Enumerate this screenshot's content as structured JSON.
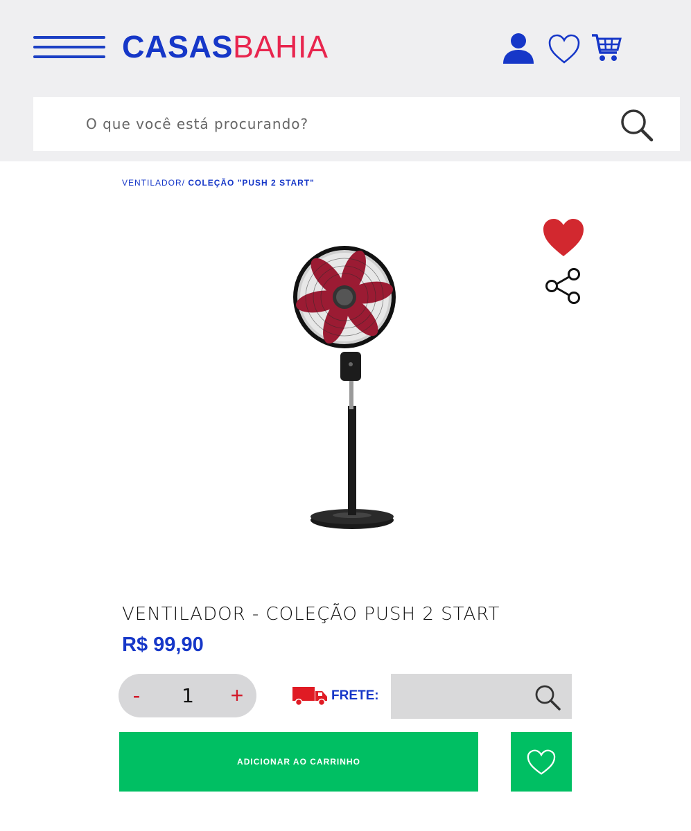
{
  "header": {
    "logo": {
      "part1": "CASAS",
      "part2": "BAHIA"
    },
    "icons": {
      "menu": "hamburger-icon",
      "user": "user-icon",
      "wishlist": "heart-outline-icon",
      "cart": "cart-icon"
    },
    "colors": {
      "brand_blue": "#1637c8",
      "brand_red": "#e8254e",
      "background": "#efeff1"
    }
  },
  "search": {
    "placeholder": "O que você está procurando?",
    "icon": "search-icon"
  },
  "breadcrumb": {
    "category": "VENTILADOR/",
    "current": "COLEÇÃO \"PUSH 2 START\""
  },
  "product": {
    "title": "VENTILADOR - COLEÇÃO PUSH 2 START",
    "price": "R$ 99,90",
    "image": "pedestal-fan-image",
    "favorite_icon": "heart-filled-icon",
    "share_icon": "share-icon"
  },
  "quantity": {
    "minus": "-",
    "value": "1",
    "plus": "+"
  },
  "frete": {
    "label": "FRETE:",
    "value": "",
    "icon": "truck-icon"
  },
  "actions": {
    "add_to_cart": "ADICIONAR AO CARRINHO",
    "wishlist_icon": "heart-outline-icon",
    "color": "#00bf63"
  }
}
